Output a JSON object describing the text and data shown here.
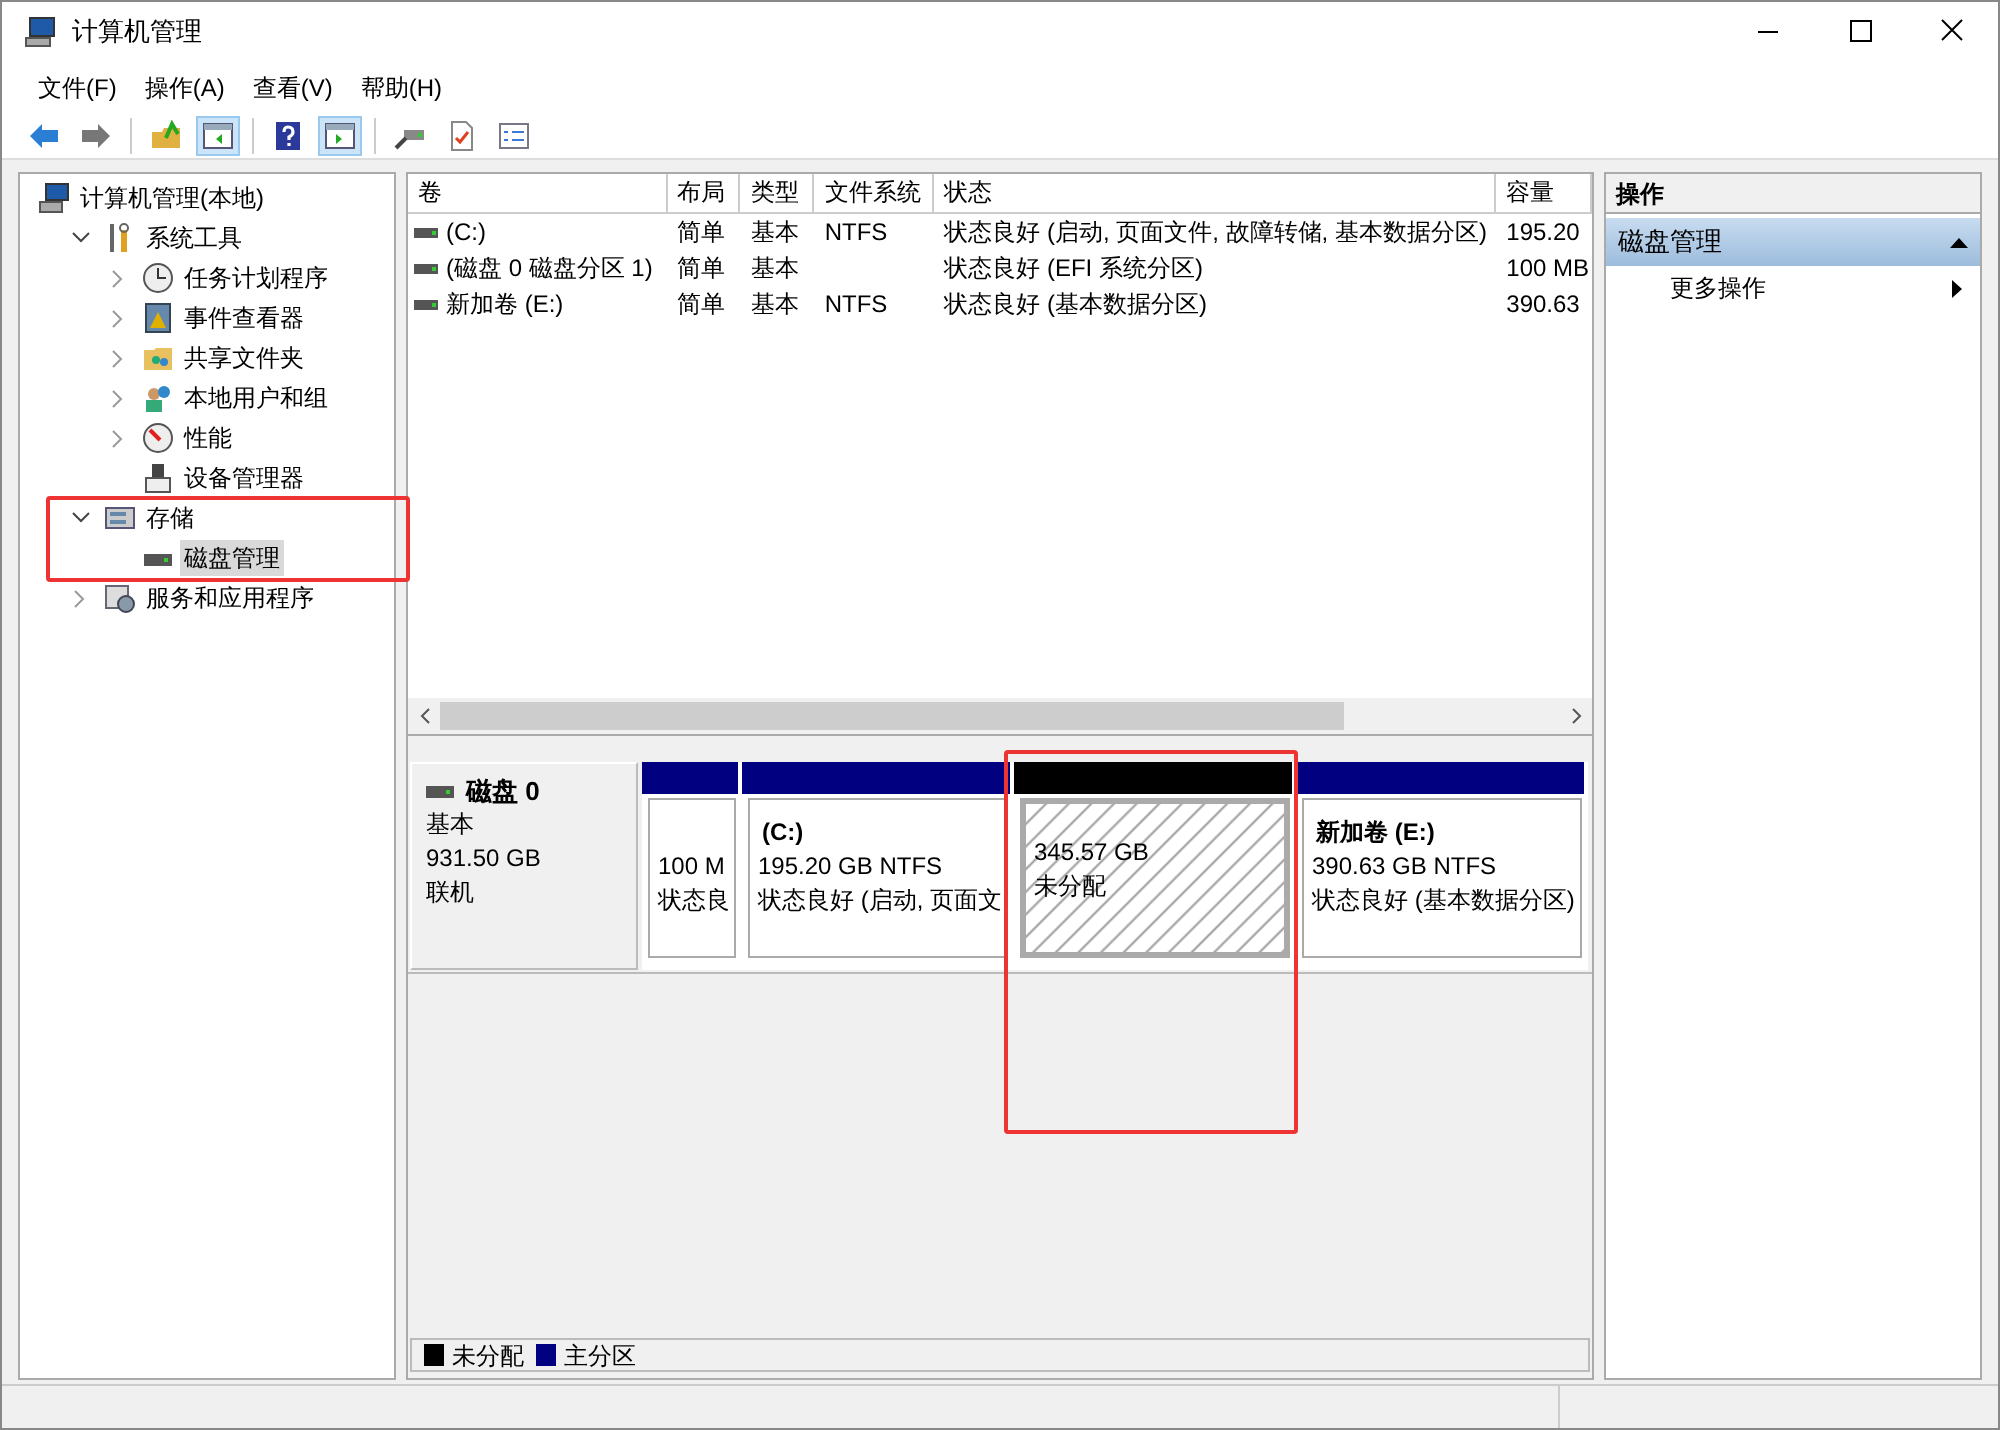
{
  "window": {
    "title": "计算机管理"
  },
  "menu": [
    "文件(F)",
    "操作(A)",
    "查看(V)",
    "帮助(H)"
  ],
  "toolbar": [
    {
      "selected": false
    },
    {
      "selected": false
    },
    {
      "selected": false
    },
    {
      "selected": true
    },
    {
      "selected": false
    },
    {
      "selected": true
    },
    {
      "selected": false
    },
    {
      "selected": false
    },
    {
      "selected": false
    }
  ],
  "tree": {
    "label": "计算机管理(本地)",
    "children": [
      {
        "label": "系统工具",
        "expanded": true,
        "children": [
          {
            "label": "任务计划程序",
            "expanded": false
          },
          {
            "label": "事件查看器",
            "expanded": false
          },
          {
            "label": "共享文件夹",
            "expanded": false
          },
          {
            "label": "本地用户和组",
            "expanded": false
          },
          {
            "label": "性能",
            "expanded": false
          },
          {
            "label": "设备管理器",
            "selected": false
          }
        ]
      },
      {
        "label": "存储",
        "expanded": true,
        "children": [
          {
            "label": "磁盘管理",
            "selected": true
          }
        ]
      },
      {
        "label": "服务和应用程序",
        "expanded": false
      }
    ]
  },
  "table": {
    "columns": [
      "卷",
      "布局",
      "类型",
      "文件系统",
      "状态",
      "容量"
    ],
    "rows": [
      [
        "(C:)",
        "简单",
        "基本",
        "NTFS",
        "状态良好 (启动, 页面文件, 故障转储, 基本数据分区)",
        "195.20"
      ],
      [
        "(磁盘 0 磁盘分区 1)",
        "简单",
        "基本",
        "",
        "状态良好 (EFI 系统分区)",
        "100 MB"
      ],
      [
        "新加卷 (E:)",
        "简单",
        "基本",
        "NTFS",
        "状态良好 (基本数据分区)",
        "390.63"
      ]
    ]
  },
  "disk": {
    "name": "磁盘 0",
    "type": "基本",
    "size": "931.50 GB",
    "status": "联机",
    "partitions": [
      {
        "kind": "primary",
        "size": "100 M",
        "status": "状态良"
      },
      {
        "kind": "primary",
        "label": "(C:)",
        "size": "195.20 GB NTFS",
        "status": "状态良好 (启动, 页面文"
      },
      {
        "kind": "unallocated",
        "size": "345.57 GB",
        "status": "未分配"
      },
      {
        "kind": "primary",
        "label": "新加卷  (E:)",
        "size": "390.63 GB NTFS",
        "status": "状态良好 (基本数据分区)"
      }
    ]
  },
  "legend": [
    {
      "label": "未分配",
      "color": "#000000"
    },
    {
      "label": "主分区",
      "color": "#000080"
    }
  ],
  "actions": {
    "title": "操作",
    "section": "磁盘管理",
    "items": [
      "更多操作"
    ]
  }
}
